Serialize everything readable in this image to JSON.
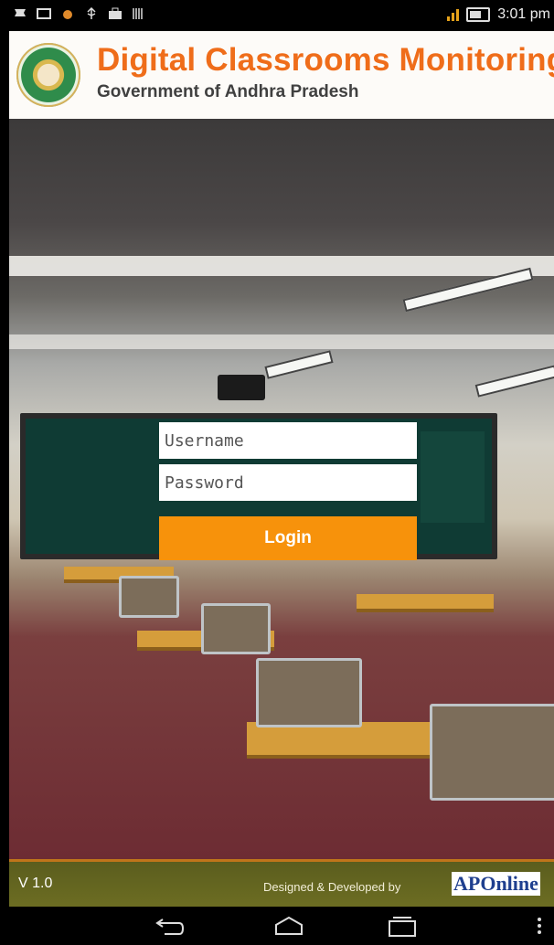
{
  "status_bar": {
    "time": "3:01 pm",
    "left_icons": [
      "notification-icon",
      "image-icon",
      "paw-icon",
      "usb-icon",
      "briefcase-icon",
      "barcode-icon"
    ],
    "right_icons": [
      "signal-icon",
      "battery-icon"
    ]
  },
  "header": {
    "title": "Digital Classrooms Monitoring",
    "subtitle": "Government of Andhra Pradesh",
    "logo_icon": "andhra-pradesh-seal-icon"
  },
  "login": {
    "username_placeholder": "Username",
    "password_placeholder": "Password",
    "login_label": "Login"
  },
  "footer": {
    "version": "V 1.0",
    "credit": "Designed & Developed  by",
    "brand": "APOnline"
  },
  "nav_bar": {
    "icons": [
      "back-icon",
      "home-icon",
      "recent-apps-icon",
      "overflow-menu-icon"
    ]
  },
  "colors": {
    "title_orange": "#ef6d1a",
    "button_orange": "#f7920b",
    "footer_olive": "#5b5d1e"
  }
}
